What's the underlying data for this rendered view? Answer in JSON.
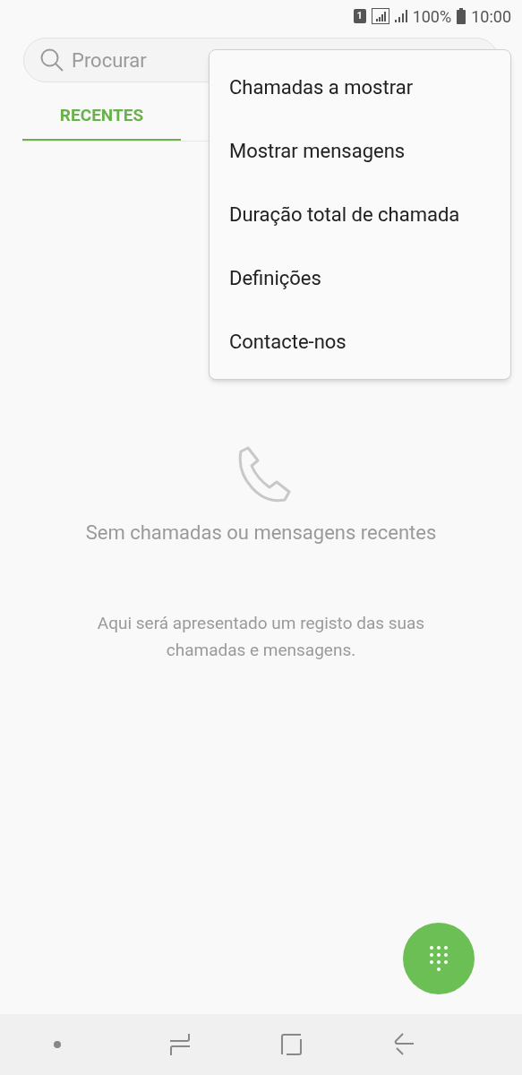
{
  "status_bar": {
    "sim": "1",
    "battery_text": "100%",
    "time": "10:00"
  },
  "search": {
    "placeholder": "Procurar"
  },
  "tabs": [
    {
      "label": "RECENTES",
      "selected": true
    }
  ],
  "menu": {
    "items": [
      "Chamadas a mostrar",
      "Mostrar mensagens",
      "Duração total de chamada",
      "Definições",
      "Contacte-nos"
    ]
  },
  "empty_state": {
    "title": "Sem chamadas ou mensagens recentes",
    "message": "Aqui será apresentado um registo das suas chamadas e mensagens."
  }
}
